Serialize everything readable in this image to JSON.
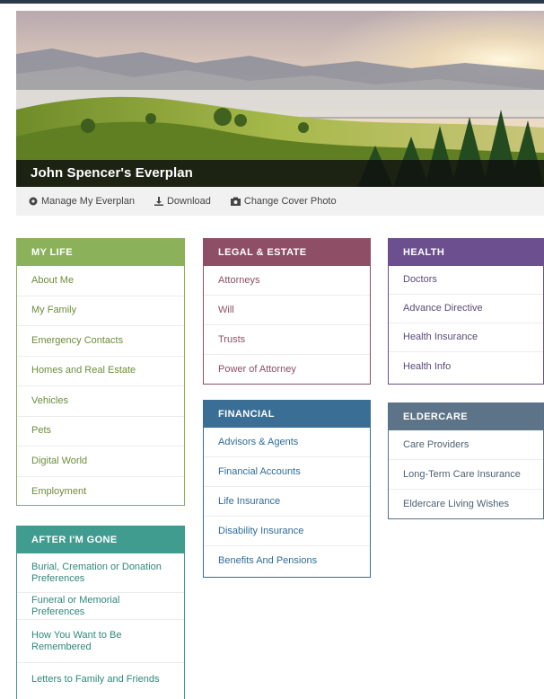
{
  "plan": {
    "title": "John Spencer's Everplan"
  },
  "actions": [
    {
      "label": "Manage My Everplan",
      "icon": "settings-icon"
    },
    {
      "label": "Download",
      "icon": "download-icon"
    },
    {
      "label": "Change Cover Photo",
      "icon": "camera-icon"
    }
  ],
  "colors": {
    "my_life": "#8bb25b",
    "legal_estate": "#8e4e66",
    "health": "#6c4f8f",
    "financial": "#3a6e94",
    "eldercare": "#5d7387",
    "after_gone": "#419c90"
  },
  "sections": {
    "my_life": {
      "title": "MY LIFE",
      "items": [
        "About Me",
        "My Family",
        "Emergency Contacts",
        "Homes and Real Estate",
        "Vehicles",
        "Pets",
        "Digital World",
        "Employment"
      ]
    },
    "legal_estate": {
      "title": "LEGAL & ESTATE",
      "items": [
        "Attorneys",
        "Will",
        "Trusts",
        "Power of Attorney"
      ]
    },
    "health": {
      "title": "HEALTH",
      "items": [
        "Doctors",
        "Advance Directive",
        "Health Insurance",
        "Health Info"
      ]
    },
    "financial": {
      "title": "FINANCIAL",
      "items": [
        "Advisors & Agents",
        "Financial Accounts",
        "Life Insurance",
        "Disability Insurance",
        "Benefits And Pensions"
      ]
    },
    "eldercare": {
      "title": "ELDERCARE",
      "items": [
        "Care Providers",
        "Long-Term Care Insurance",
        "Eldercare Living Wishes"
      ]
    },
    "after_gone": {
      "title": "AFTER I'M GONE",
      "items": [
        "Burial, Cremation or Donation Preferences",
        "Funeral or Memorial Preferences",
        "How You Want to Be Remembered",
        "Letters to Family and Friends"
      ]
    }
  }
}
